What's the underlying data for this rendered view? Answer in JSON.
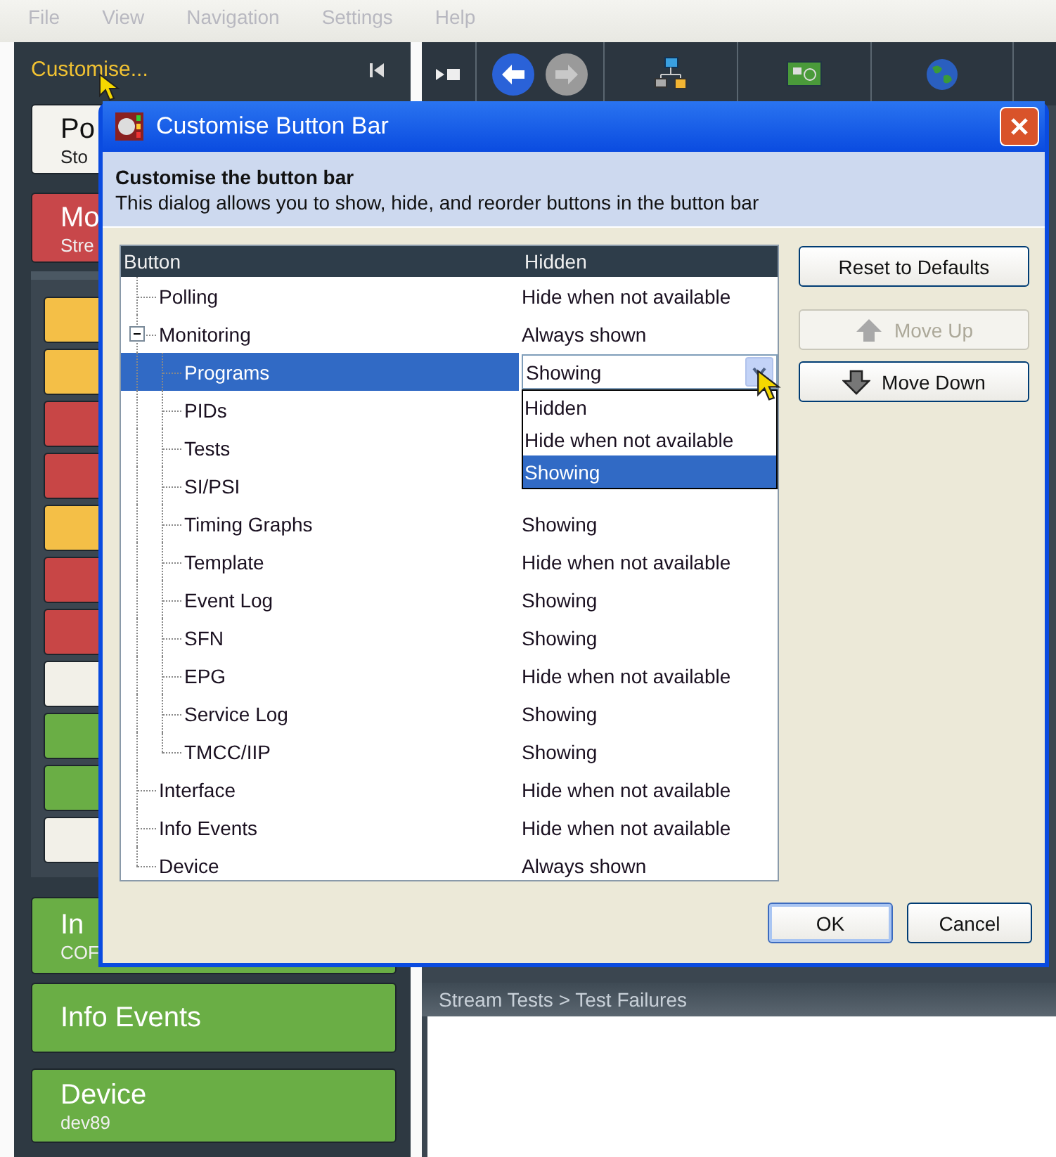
{
  "menu_bar": [
    "File",
    "View",
    "Navigation",
    "Settings",
    "Help"
  ],
  "sidebar": {
    "header": "Customise...",
    "top_cards": [
      {
        "title": "Po",
        "subtitle": "Sto",
        "color": "#f4f3ee"
      },
      {
        "title": "Mo",
        "subtitle": "Stre",
        "color": "#c8474a"
      }
    ],
    "tiles": [
      {
        "color": "#f4bf47"
      },
      {
        "color": "#f4bf47"
      },
      {
        "color": "#c84646"
      },
      {
        "color": "#c84646"
      },
      {
        "color": "#f4bf47"
      },
      {
        "color": "#c84646"
      },
      {
        "color": "#c84646"
      },
      {
        "color": "#f2f0e8"
      },
      {
        "color": "#6aae45"
      },
      {
        "color": "#6aae45"
      },
      {
        "color": "#f2f0e8"
      }
    ],
    "bottom_cards": [
      {
        "title": "In",
        "subtitle": "COF",
        "color": "#6aae45"
      },
      {
        "title": "Info Events",
        "color": "#6aae45"
      },
      {
        "title": "Device",
        "subtitle": "dev89",
        "color": "#6aae45"
      }
    ]
  },
  "panel": {
    "title": "Stream Tests > Test Failures"
  },
  "dialog": {
    "title": "Customise Button Bar",
    "heading": "Customise the button bar",
    "description": "This dialog allows you to show, hide, and reorder buttons in the button bar",
    "columns": [
      "Button",
      "Hidden"
    ],
    "rows": [
      {
        "label": "Polling",
        "hidden": "Hide when not available",
        "selected": false
      },
      {
        "label": "Monitoring",
        "hidden": "Always shown",
        "selected": false,
        "expanded": true,
        "children": [
          {
            "label": "Programs",
            "selected": true,
            "dropdown": {
              "value": "Showing",
              "options": [
                {
                  "label": "Hidden",
                  "selected": false
                },
                {
                  "label": "Hide when not available",
                  "selected": false
                },
                {
                  "label": "Showing",
                  "selected": true
                }
              ]
            }
          },
          {
            "label": "PIDs",
            "selected": false
          },
          {
            "label": "Tests",
            "selected": false
          },
          {
            "label": "SI/PSI",
            "selected": false
          },
          {
            "label": "Timing Graphs",
            "hidden": "Showing",
            "selected": false
          },
          {
            "label": "Template",
            "hidden": "Hide when not available",
            "selected": false
          },
          {
            "label": "Event Log",
            "hidden": "Showing",
            "selected": false
          },
          {
            "label": "SFN",
            "hidden": "Showing",
            "selected": false
          },
          {
            "label": "EPG",
            "hidden": "Hide when not available",
            "selected": false
          },
          {
            "label": "Service Log",
            "hidden": "Showing",
            "selected": false
          },
          {
            "label": "TMCC/IIP",
            "hidden": "Showing",
            "selected": false
          }
        ]
      },
      {
        "label": "Interface",
        "hidden": "Hide when not available",
        "selected": false
      },
      {
        "label": "Info Events",
        "hidden": "Hide when not available",
        "selected": false
      },
      {
        "label": "Device",
        "hidden": "Always shown",
        "selected": false
      }
    ],
    "side_buttons": [
      {
        "label": "Reset to Defaults",
        "kind": "reset",
        "disabled": false
      },
      {
        "label": "Move Up",
        "kind": "up",
        "disabled": true
      },
      {
        "label": "Move Down",
        "kind": "down",
        "disabled": false
      }
    ],
    "footer_buttons": [
      {
        "label": "OK",
        "focused": true
      },
      {
        "label": "Cancel",
        "focused": false
      }
    ]
  }
}
